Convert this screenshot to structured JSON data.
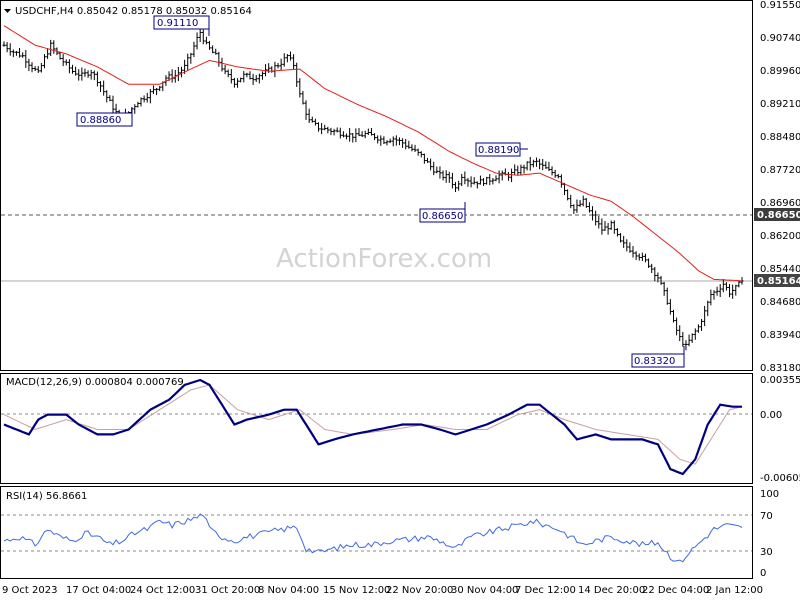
{
  "symbol_header": "USDCHF,H4  0.85042 0.85178 0.85032 0.85164",
  "watermark": "ActionForex.com",
  "colors": {
    "price": "#000000",
    "ma": "#e0201a",
    "macd": "#000080",
    "signal": "#c8a0a0",
    "rsi": "#4169e1",
    "grid": "#555555",
    "annotation": "#000080",
    "badge_dark": "#3c3c3c",
    "badge_cur": "#444444"
  },
  "price_axis_ticks": [
    "0.91550",
    "0.90740",
    "0.89960",
    "0.89210",
    "0.88480",
    "0.87720",
    "0.86960",
    "0.86200",
    "0.85440",
    "0.84680",
    "0.83940",
    "0.83180"
  ],
  "macd_axis_ticks": [
    "0.003555",
    "0.00",
    "-0.00605"
  ],
  "rsi_axis_ticks": [
    "100",
    "70",
    "30",
    "0"
  ],
  "time_labels": [
    "9 Oct 2023",
    "17 Oct 04:00",
    "24 Oct 12:00",
    "31 Oct 20:00",
    "8 Nov 04:00",
    "15 Nov 12:00",
    "22 Nov 20:00",
    "30 Nov 04:00",
    "7 Dec 12:00",
    "14 Dec 20:00",
    "22 Dec 04:00",
    "2 Jan 12:00"
  ],
  "macd_header": "MACD(12,26,9) 0.000804 0.000769",
  "rsi_header": "RSI(14) 56.8661",
  "annotations": [
    {
      "label": "0.91110"
    },
    {
      "label": "0.88860"
    },
    {
      "label": "0.88190"
    },
    {
      "label": "0.86650"
    },
    {
      "label": "0.83320"
    }
  ],
  "level_badges": [
    {
      "label": "0.86650"
    },
    {
      "label": "0.85164"
    }
  ],
  "chart_data": [
    {
      "type": "bar",
      "title": "USDCHF,H4",
      "ohlc_last": {
        "open": 0.85042,
        "high": 0.85178,
        "low": 0.85032,
        "close": 0.85164
      },
      "ylim": [
        0.8318,
        0.9155
      ],
      "x_labels": [
        "9 Oct 2023",
        "17 Oct 04:00",
        "24 Oct 12:00",
        "31 Oct 20:00",
        "8 Nov 04:00",
        "15 Nov 12:00",
        "22 Nov 20:00",
        "30 Nov 04:00",
        "7 Dec 12:00",
        "14 Dec 20:00",
        "22 Dec 04:00",
        "2 Jan 12:00"
      ],
      "close_path": [
        [
          0,
          0.906
        ],
        [
          3,
          0.9045
        ],
        [
          6,
          0.9035
        ],
        [
          9,
          0.901
        ],
        [
          11,
          0.8995
        ],
        [
          13,
          0.903
        ],
        [
          15,
          0.906
        ],
        [
          18,
          0.903
        ],
        [
          22,
          0.9
        ],
        [
          25,
          0.899
        ],
        [
          28,
          0.9
        ],
        [
          30,
          0.898
        ],
        [
          33,
          0.894
        ],
        [
          36,
          0.8905
        ],
        [
          38,
          0.889
        ],
        [
          40,
          0.8905
        ],
        [
          43,
          0.893
        ],
        [
          46,
          0.8945
        ],
        [
          49,
          0.896
        ],
        [
          52,
          0.8985
        ],
        [
          55,
          0.899
        ],
        [
          58,
          0.901
        ],
        [
          60,
          0.904
        ],
        [
          62,
          0.9075
        ],
        [
          63,
          0.909
        ],
        [
          65,
          0.906
        ],
        [
          68,
          0.9035
        ],
        [
          71,
          0.8995
        ],
        [
          74,
          0.8975
        ],
        [
          77,
          0.899
        ],
        [
          80,
          0.8985
        ],
        [
          83,
          0.8995
        ],
        [
          86,
          0.9005
        ],
        [
          89,
          0.902
        ],
        [
          91,
          0.9035
        ],
        [
          93,
          0.9015
        ],
        [
          95,
          0.8945
        ],
        [
          98,
          0.8885
        ],
        [
          101,
          0.887
        ],
        [
          104,
          0.8865
        ],
        [
          107,
          0.886
        ],
        [
          110,
          0.8855
        ],
        [
          113,
          0.885
        ],
        [
          116,
          0.8855
        ],
        [
          119,
          0.885
        ],
        [
          122,
          0.884
        ],
        [
          125,
          0.8845
        ],
        [
          128,
          0.8835
        ],
        [
          131,
          0.882
        ],
        [
          134,
          0.8805
        ],
        [
          137,
          0.878
        ],
        [
          140,
          0.876
        ],
        [
          143,
          0.8755
        ],
        [
          145,
          0.873
        ],
        [
          147,
          0.876
        ],
        [
          150,
          0.8745
        ],
        [
          153,
          0.8745
        ],
        [
          156,
          0.875
        ],
        [
          159,
          0.876
        ],
        [
          162,
          0.876
        ],
        [
          165,
          0.877
        ],
        [
          168,
          0.8785
        ],
        [
          171,
          0.879
        ],
        [
          173,
          0.878
        ],
        [
          175,
          0.877
        ],
        [
          178,
          0.876
        ],
        [
          181,
          0.871
        ],
        [
          183,
          0.868
        ],
        [
          186,
          0.87
        ],
        [
          189,
          0.8665
        ],
        [
          192,
          0.8635
        ],
        [
          195,
          0.8645
        ],
        [
          198,
          0.8605
        ],
        [
          201,
          0.859
        ],
        [
          204,
          0.8575
        ],
        [
          207,
          0.8555
        ],
        [
          210,
          0.8525
        ],
        [
          213,
          0.847
        ],
        [
          215,
          0.842
        ],
        [
          217,
          0.8385
        ],
        [
          219,
          0.8365
        ],
        [
          221,
          0.839
        ],
        [
          223,
          0.841
        ],
        [
          225,
          0.8445
        ],
        [
          227,
          0.8485
        ],
        [
          229,
          0.8495
        ],
        [
          231,
          0.851
        ],
        [
          233,
          0.849
        ],
        [
          235,
          0.85
        ],
        [
          237,
          0.8516
        ]
      ],
      "moving_average_path": [
        [
          0,
          0.9105
        ],
        [
          10,
          0.906
        ],
        [
          20,
          0.904
        ],
        [
          30,
          0.901
        ],
        [
          40,
          0.897
        ],
        [
          50,
          0.897
        ],
        [
          60,
          0.9005
        ],
        [
          66,
          0.9025
        ],
        [
          75,
          0.901
        ],
        [
          85,
          0.9
        ],
        [
          95,
          0.9005
        ],
        [
          103,
          0.896
        ],
        [
          113,
          0.8925
        ],
        [
          123,
          0.8895
        ],
        [
          133,
          0.886
        ],
        [
          143,
          0.8815
        ],
        [
          150,
          0.879
        ],
        [
          158,
          0.8765
        ],
        [
          165,
          0.876
        ],
        [
          172,
          0.8765
        ],
        [
          180,
          0.874
        ],
        [
          188,
          0.8715
        ],
        [
          195,
          0.87
        ],
        [
          202,
          0.8665
        ],
        [
          210,
          0.862
        ],
        [
          217,
          0.858
        ],
        [
          223,
          0.854
        ],
        [
          228,
          0.852
        ],
        [
          237,
          0.8517
        ]
      ]
    },
    {
      "type": "line",
      "title": "MACD(12,26,9)",
      "ylim": [
        -0.0065,
        0.0036
      ],
      "series": [
        {
          "name": "MACD",
          "values_path": [
            [
              0,
              -0.001
            ],
            [
              8,
              -0.002
            ],
            [
              11,
              -0.0005
            ],
            [
              14,
              0.0
            ],
            [
              20,
              0.0
            ],
            [
              24,
              -0.001
            ],
            [
              30,
              -0.002
            ],
            [
              35,
              -0.002
            ],
            [
              40,
              -0.0015
            ],
            [
              47,
              0.0005
            ],
            [
              53,
              0.0015
            ],
            [
              58,
              0.003
            ],
            [
              63,
              0.0035
            ],
            [
              66,
              0.003
            ],
            [
              70,
              0.001
            ],
            [
              74,
              -0.001
            ],
            [
              78,
              -0.0005
            ],
            [
              85,
              0.0
            ],
            [
              90,
              0.0005
            ],
            [
              94,
              0.0005
            ],
            [
              97,
              -0.001
            ],
            [
              101,
              -0.003
            ],
            [
              106,
              -0.0025
            ],
            [
              112,
              -0.002
            ],
            [
              120,
              -0.0015
            ],
            [
              128,
              -0.001
            ],
            [
              134,
              -0.001
            ],
            [
              140,
              -0.0015
            ],
            [
              145,
              -0.002
            ],
            [
              150,
              -0.0015
            ],
            [
              155,
              -0.001
            ],
            [
              162,
              0.0
            ],
            [
              168,
              0.001
            ],
            [
              172,
              0.001
            ],
            [
              176,
              0.0
            ],
            [
              180,
              -0.001
            ],
            [
              184,
              -0.0025
            ],
            [
              190,
              -0.002
            ],
            [
              195,
              -0.0025
            ],
            [
              200,
              -0.0025
            ],
            [
              205,
              -0.0025
            ],
            [
              210,
              -0.003
            ],
            [
              214,
              -0.0055
            ],
            [
              218,
              -0.006
            ],
            [
              222,
              -0.0045
            ],
            [
              226,
              -0.001
            ],
            [
              230,
              0.001
            ],
            [
              234,
              0.0008
            ],
            [
              237,
              0.0008
            ]
          ]
        },
        {
          "name": "Signal",
          "values_path": [
            [
              0,
              0.0
            ],
            [
              10,
              -0.0015
            ],
            [
              20,
              -0.0005
            ],
            [
              30,
              -0.0015
            ],
            [
              40,
              -0.0015
            ],
            [
              50,
              0.0005
            ],
            [
              60,
              0.0025
            ],
            [
              66,
              0.003
            ],
            [
              75,
              0.0005
            ],
            [
              85,
              -0.0005
            ],
            [
              95,
              0.0005
            ],
            [
              103,
              -0.0015
            ],
            [
              112,
              -0.002
            ],
            [
              125,
              -0.0015
            ],
            [
              135,
              -0.001
            ],
            [
              145,
              -0.0015
            ],
            [
              155,
              -0.0015
            ],
            [
              165,
              0.0
            ],
            [
              172,
              0.0005
            ],
            [
              180,
              -0.0005
            ],
            [
              190,
              -0.0015
            ],
            [
              200,
              -0.002
            ],
            [
              210,
              -0.0025
            ],
            [
              217,
              -0.0045
            ],
            [
              222,
              -0.005
            ],
            [
              228,
              -0.002
            ],
            [
              233,
              0.0005
            ],
            [
              237,
              0.0008
            ]
          ]
        }
      ]
    },
    {
      "type": "line",
      "title": "RSI(14)",
      "ylim": [
        0,
        100
      ],
      "reference_levels": [
        70,
        30
      ],
      "series": [
        {
          "name": "RSI(14)",
          "values_path": [
            [
              0,
              40
            ],
            [
              5,
              45
            ],
            [
              10,
              35
            ],
            [
              14,
              55
            ],
            [
              18,
              45
            ],
            [
              22,
              40
            ],
            [
              26,
              50
            ],
            [
              30,
              45
            ],
            [
              34,
              35
            ],
            [
              38,
              40
            ],
            [
              42,
              50
            ],
            [
              46,
              55
            ],
            [
              50,
              65
            ],
            [
              54,
              60
            ],
            [
              58,
              65
            ],
            [
              62,
              70
            ],
            [
              64,
              75
            ],
            [
              66,
              55
            ],
            [
              70,
              45
            ],
            [
              74,
              40
            ],
            [
              78,
              45
            ],
            [
              82,
              48
            ],
            [
              86,
              52
            ],
            [
              90,
              55
            ],
            [
              94,
              58
            ],
            [
              97,
              30
            ],
            [
              101,
              25
            ],
            [
              106,
              30
            ],
            [
              112,
              35
            ],
            [
              118,
              35
            ],
            [
              124,
              40
            ],
            [
              130,
              42
            ],
            [
              136,
              45
            ],
            [
              140,
              40
            ],
            [
              145,
              30
            ],
            [
              150,
              45
            ],
            [
              155,
              50
            ],
            [
              160,
              55
            ],
            [
              165,
              60
            ],
            [
              170,
              65
            ],
            [
              174,
              60
            ],
            [
              178,
              55
            ],
            [
              182,
              45
            ],
            [
              186,
              35
            ],
            [
              190,
              40
            ],
            [
              195,
              45
            ],
            [
              200,
              40
            ],
            [
              205,
              35
            ],
            [
              210,
              38
            ],
            [
              214,
              20
            ],
            [
              217,
              12
            ],
            [
              220,
              25
            ],
            [
              224,
              40
            ],
            [
              228,
              55
            ],
            [
              232,
              60
            ],
            [
              237,
              56.87
            ]
          ]
        }
      ]
    }
  ]
}
